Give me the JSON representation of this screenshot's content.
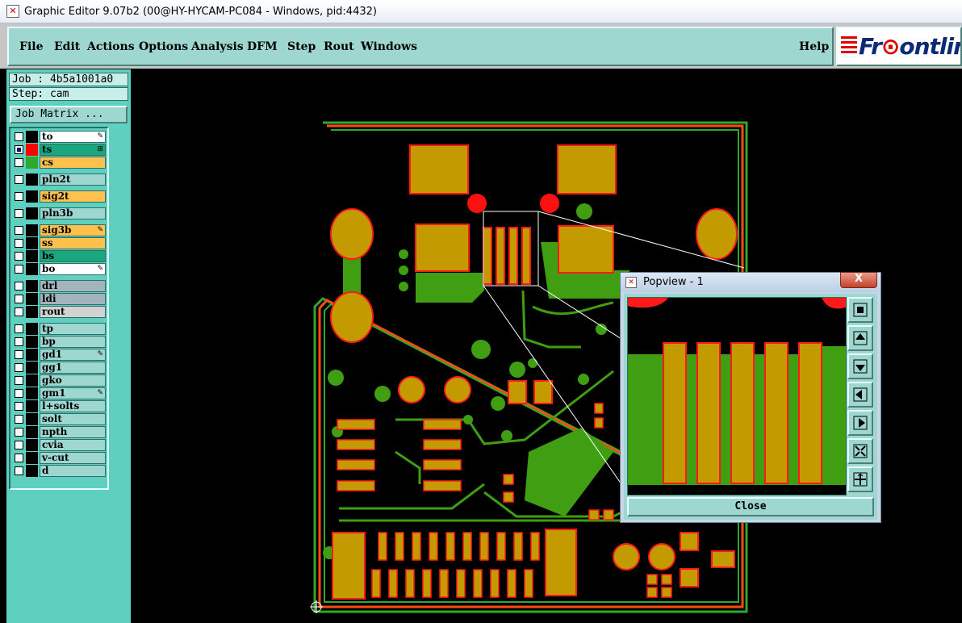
{
  "window": {
    "title": "Graphic Editor 9.07b2 (00@HY-HYCAM-PC084 - Windows, pid:4432)"
  },
  "menu": [
    "File",
    "Edit",
    "Actions",
    "Options",
    "Analysis",
    "DFM",
    "Step",
    "Rout",
    "Windows"
  ],
  "help_label": "Help",
  "brand": {
    "name_prefix": "F",
    "name_o_mark": "r",
    "name_rest": "ontline"
  },
  "job": {
    "job_line": "Job : 4b5a1001a0",
    "step_line": "Step: cam",
    "matrix_button": "Job Matrix ..."
  },
  "layers": [
    {
      "name": "to",
      "color": "#ffffff",
      "swatch": "#000000",
      "mark": "✎",
      "group": 1
    },
    {
      "name": "ts",
      "color": "#1aa77d",
      "swatch": "#ff0000",
      "mark": "⊞",
      "group": 1,
      "selected": true
    },
    {
      "name": "cs",
      "color": "#ffc14d",
      "swatch": "#2ea82e",
      "mark": "",
      "group": 1
    },
    {
      "name": "pln2t",
      "color": "#9ed6d0",
      "swatch": "#000000",
      "mark": "",
      "group": 2
    },
    {
      "name": "sig2t",
      "color": "#ffc14d",
      "swatch": "#000000",
      "mark": "",
      "group": 3
    },
    {
      "name": "pln3b",
      "color": "#9ed6d0",
      "swatch": "#000000",
      "mark": "",
      "group": 4
    },
    {
      "name": "sig3b",
      "color": "#ffc14d",
      "swatch": "#000000",
      "mark": "✎",
      "group": 5
    },
    {
      "name": "ss",
      "color": "#ffc14d",
      "swatch": "#000000",
      "mark": "",
      "group": 5
    },
    {
      "name": "bs",
      "color": "#1aa77d",
      "swatch": "#000000",
      "mark": "",
      "group": 5
    },
    {
      "name": "bo",
      "color": "#ffffff",
      "swatch": "#000000",
      "mark": "✎",
      "group": 5
    },
    {
      "name": "drl",
      "color": "#a4b4bc",
      "swatch": "#000000",
      "mark": "",
      "group": 6
    },
    {
      "name": "ldi",
      "color": "#a4b4bc",
      "swatch": "#000000",
      "mark": "",
      "group": 6
    },
    {
      "name": "rout",
      "color": "#d2d2d2",
      "swatch": "#000000",
      "mark": "",
      "group": 6
    },
    {
      "name": "tp",
      "color": "#9ed6d0",
      "swatch": "#000000",
      "mark": "",
      "group": 7
    },
    {
      "name": "bp",
      "color": "#9ed6d0",
      "swatch": "#000000",
      "mark": "",
      "group": 7
    },
    {
      "name": "gd1",
      "color": "#9ed6d0",
      "swatch": "#000000",
      "mark": "✎",
      "group": 7
    },
    {
      "name": "gg1",
      "color": "#9ed6d0",
      "swatch": "#000000",
      "mark": "",
      "group": 7
    },
    {
      "name": "gko",
      "color": "#9ed6d0",
      "swatch": "#000000",
      "mark": "",
      "group": 7
    },
    {
      "name": "gm1",
      "color": "#9ed6d0",
      "swatch": "#000000",
      "mark": "✎",
      "group": 7
    },
    {
      "name": "l+solts",
      "color": "#9ed6d0",
      "swatch": "#000000",
      "mark": "",
      "group": 7
    },
    {
      "name": "solt",
      "color": "#9ed6d0",
      "swatch": "#000000",
      "mark": "",
      "group": 7
    },
    {
      "name": "npth",
      "color": "#9ed6d0",
      "swatch": "#000000",
      "mark": "",
      "group": 7
    },
    {
      "name": "cvia",
      "color": "#9ed6d0",
      "swatch": "#000000",
      "mark": "",
      "group": 7
    },
    {
      "name": "v-cut",
      "color": "#9ed6d0",
      "swatch": "#000000",
      "mark": "",
      "group": 7
    },
    {
      "name": "d",
      "color": "#9ed6d0",
      "swatch": "#000000",
      "mark": "",
      "group": 7
    }
  ],
  "popview": {
    "title": "Popview - 1",
    "close_label": "Close",
    "close_x": "X",
    "tools": [
      "zoom-fit-icon",
      "pan-up-icon",
      "pan-down-icon",
      "pan-left-icon",
      "pan-right-icon",
      "zoom-in-icon",
      "zoom-out-icon"
    ]
  },
  "colors": {
    "copper_top": "#c39a00",
    "pad_outline": "#ff1a1a",
    "bottom_layer": "#3f9e12",
    "panel": "#9ed6d0"
  }
}
